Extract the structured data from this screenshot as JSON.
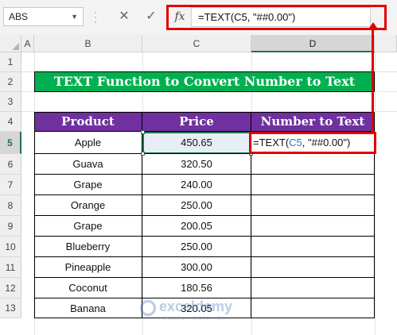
{
  "formula_bar": {
    "name_box": "ABS",
    "cancel_icon": "close-icon",
    "enter_icon": "check-icon",
    "fx_label": "fx",
    "formula": "=TEXT(C5, \"##0.00\")"
  },
  "columns": [
    "A",
    "B",
    "C",
    "D"
  ],
  "rows": [
    "1",
    "2",
    "3",
    "4",
    "5",
    "6",
    "7",
    "8",
    "9",
    "10",
    "11",
    "12",
    "13"
  ],
  "title": "TEXT Function to Convert Number to Text",
  "table": {
    "headers": [
      "Product",
      "Price",
      "Number to Text"
    ],
    "rows": [
      {
        "product": "Apple",
        "price": "450.65"
      },
      {
        "product": "Guava",
        "price": "320.50"
      },
      {
        "product": "Grape",
        "price": "240.00"
      },
      {
        "product": "Orange",
        "price": "250.00"
      },
      {
        "product": "Grape",
        "price": "200.05"
      },
      {
        "product": "Blueberry",
        "price": "250.00"
      },
      {
        "product": "Pineapple",
        "price": "300.00"
      },
      {
        "product": "Coconut",
        "price": "180.56"
      },
      {
        "product": "Banana",
        "price": "320.05"
      }
    ],
    "d5_formula": {
      "prefix": "=TEXT(",
      "ref": "C5",
      "suffix": ", \"##0.00\")"
    }
  },
  "colors": {
    "title_bg": "#00b050",
    "header_bg": "#7030a0",
    "highlight": "#e00000",
    "selection": "#217346"
  },
  "watermark": {
    "name": "exceldemy",
    "tagline": "EXCEL · DATA · BI"
  }
}
